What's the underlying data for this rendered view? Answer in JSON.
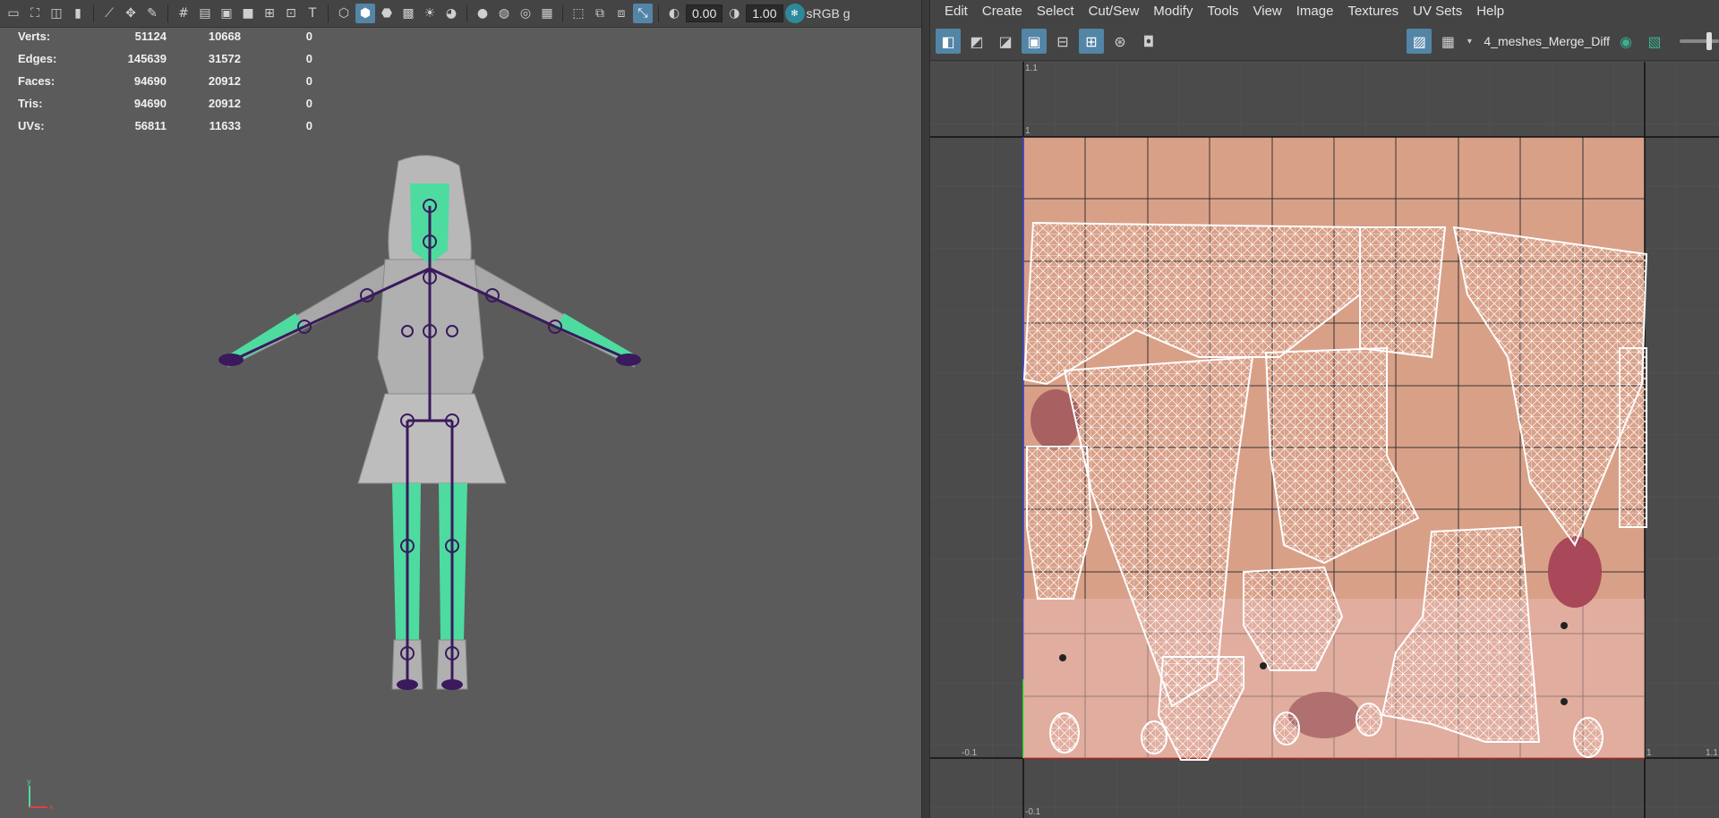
{
  "viewport_toolbar": {
    "range_start": "0.00",
    "range_end": "1.00",
    "colorspace": "sRGB g"
  },
  "hud": {
    "rows": [
      {
        "label": "Verts:",
        "v1": "51124",
        "v2": "10668",
        "v3": "0"
      },
      {
        "label": "Edges:",
        "v1": "145639",
        "v2": "31572",
        "v3": "0"
      },
      {
        "label": "Faces:",
        "v1": "94690",
        "v2": "20912",
        "v3": "0"
      },
      {
        "label": "Tris:",
        "v1": "94690",
        "v2": "20912",
        "v3": "0"
      },
      {
        "label": "UVs:",
        "v1": "56811",
        "v2": "11633",
        "v3": "0"
      }
    ]
  },
  "uv_editor": {
    "menu": [
      "Edit",
      "Create",
      "Select",
      "Cut/Sew",
      "Modify",
      "Tools",
      "View",
      "Image",
      "Textures",
      "UV Sets",
      "Help"
    ],
    "texture_name": "4_meshes_Merge_Diff",
    "axis_labels": {
      "top_left": "1.1",
      "one_left": "1",
      "neg_bottom": "-0.1",
      "right_one": "1",
      "right_one_one": "1.1",
      "bottom": "-0.1"
    }
  },
  "colors": {
    "viewport_bg": "#5b5b5b",
    "skin_texture": "#d9a088",
    "selection_green": "#4ddba0",
    "joint_purple": "#3a1a5c",
    "active_blue": "#5285a6"
  },
  "icons": {
    "axis_gizmo": "xyz-axis-icon"
  }
}
